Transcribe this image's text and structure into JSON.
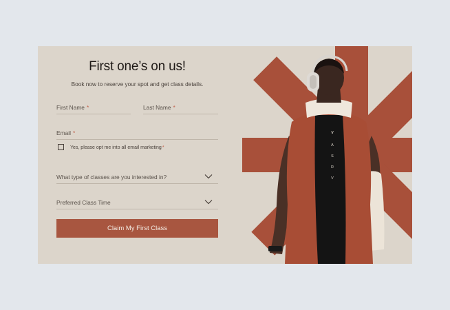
{
  "form": {
    "title": "First one’s on us!",
    "subtitle": "Book now to reserve your spot and get class details.",
    "first_name_label": "First Name",
    "last_name_label": "Last Name",
    "email_label": "Email",
    "required_marker": "*",
    "opt_in_label": "Yes, please opt me into all email marketing",
    "opt_in_checked": false,
    "class_type_label": "What type of classes are you interested in?",
    "class_time_label": "Preferred Class Time",
    "submit_label": "Claim My First Class"
  },
  "hero": {
    "jersey_letters": [
      "A",
      "S",
      "R",
      "V"
    ]
  },
  "colors": {
    "page_bg": "#e3e7ec",
    "card_bg": "#dcd5cb",
    "accent": "#a85640",
    "graphic_red": "#a8503a"
  }
}
